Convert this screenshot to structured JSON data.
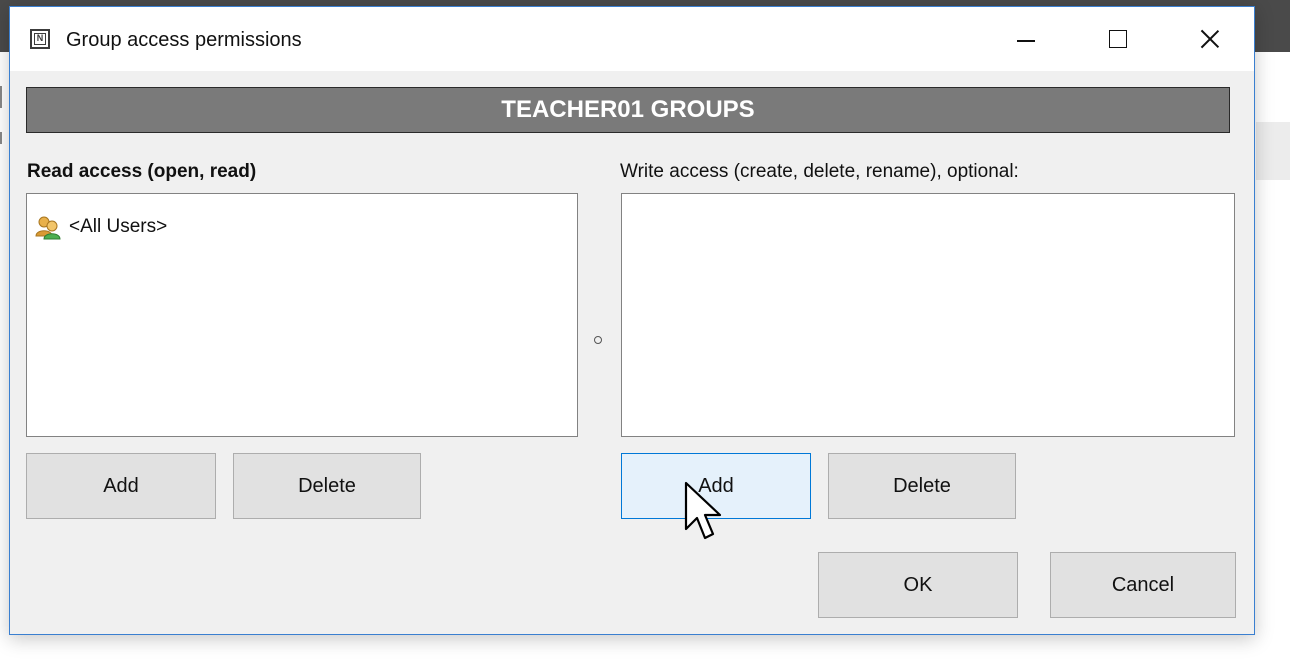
{
  "window": {
    "title": "Group access permissions",
    "icon": "app-n-icon",
    "controls": [
      "minimize-icon",
      "maximize-icon",
      "close-icon"
    ]
  },
  "banner": {
    "text": "TEACHER01 GROUPS"
  },
  "read_access": {
    "label": "Read access (open, read)",
    "items": [
      {
        "label": "<All Users>",
        "icon": "users-icon"
      }
    ],
    "add_label": "Add",
    "delete_label": "Delete"
  },
  "write_access": {
    "label": "Write access (create, delete, rename), optional:",
    "items": [],
    "add_label": "Add",
    "delete_label": "Delete"
  },
  "footer": {
    "ok_label": "OK",
    "cancel_label": "Cancel"
  },
  "colors": {
    "banner_bg": "#7a7a7a",
    "focus_border": "#0078d7",
    "focus_bg": "#e5f1fb",
    "window_border": "#3a7fd0"
  }
}
